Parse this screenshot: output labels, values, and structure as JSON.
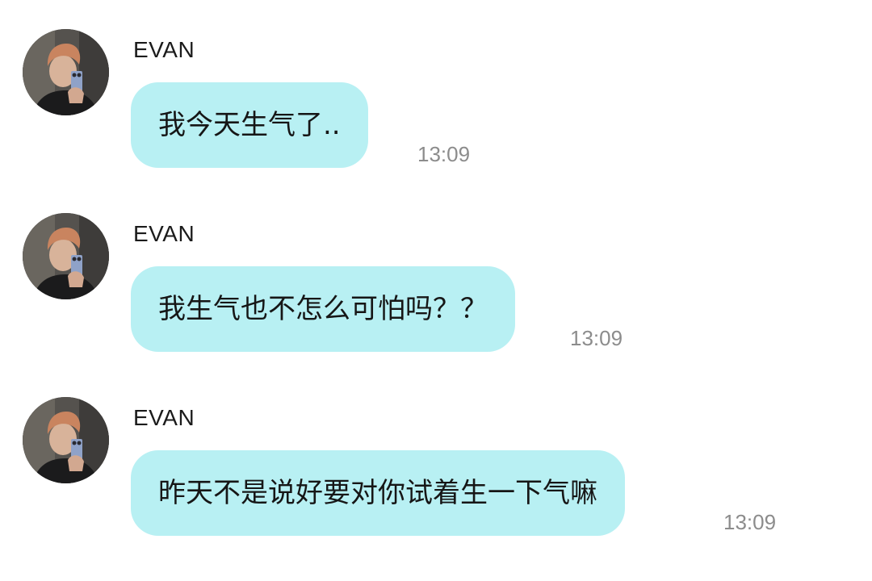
{
  "messages": [
    {
      "sender": "EVAN",
      "text": "我今天生气了..",
      "time": "13:09"
    },
    {
      "sender": "EVAN",
      "text": "我生气也不怎么可怕吗？？",
      "time": "13:09"
    },
    {
      "sender": "EVAN",
      "text": "昨天不是说好要对你试着生一下气嘛",
      "time": "13:09"
    }
  ],
  "colors": {
    "bubble": "#b8f0f3",
    "sender_text": "#1b1b1b",
    "time_text": "#8c8c8c",
    "background": "#ffffff"
  },
  "icons": {
    "avatar": "profile-photo-avatar"
  }
}
